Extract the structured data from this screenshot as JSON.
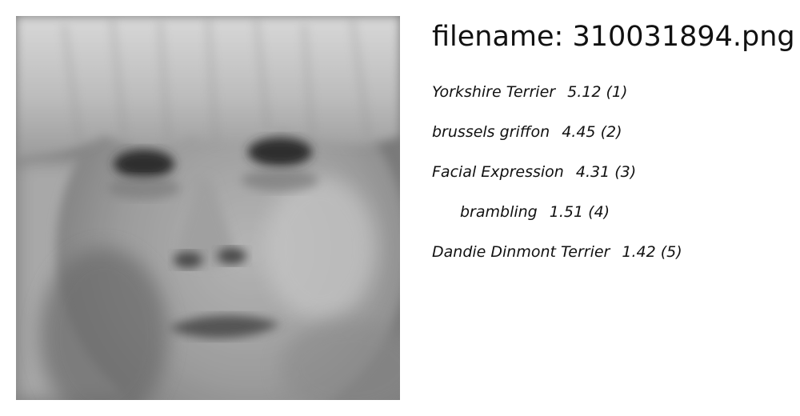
{
  "filename_label": "filename: 310031894.png",
  "predictions": [
    {
      "label": "Yorkshire Terrier",
      "score": "5.12",
      "rank": "(1)"
    },
    {
      "label": "brussels griffon",
      "score": "4.45",
      "rank": "(2)"
    },
    {
      "label": "Facial Expression",
      "score": "4.31",
      "rank": "(3)"
    },
    {
      "label": "brambling",
      "score": "1.51",
      "rank": "(4)"
    },
    {
      "label": "Dandie Dinmont Terrier",
      "score": "1.42",
      "rank": "(5)"
    }
  ]
}
